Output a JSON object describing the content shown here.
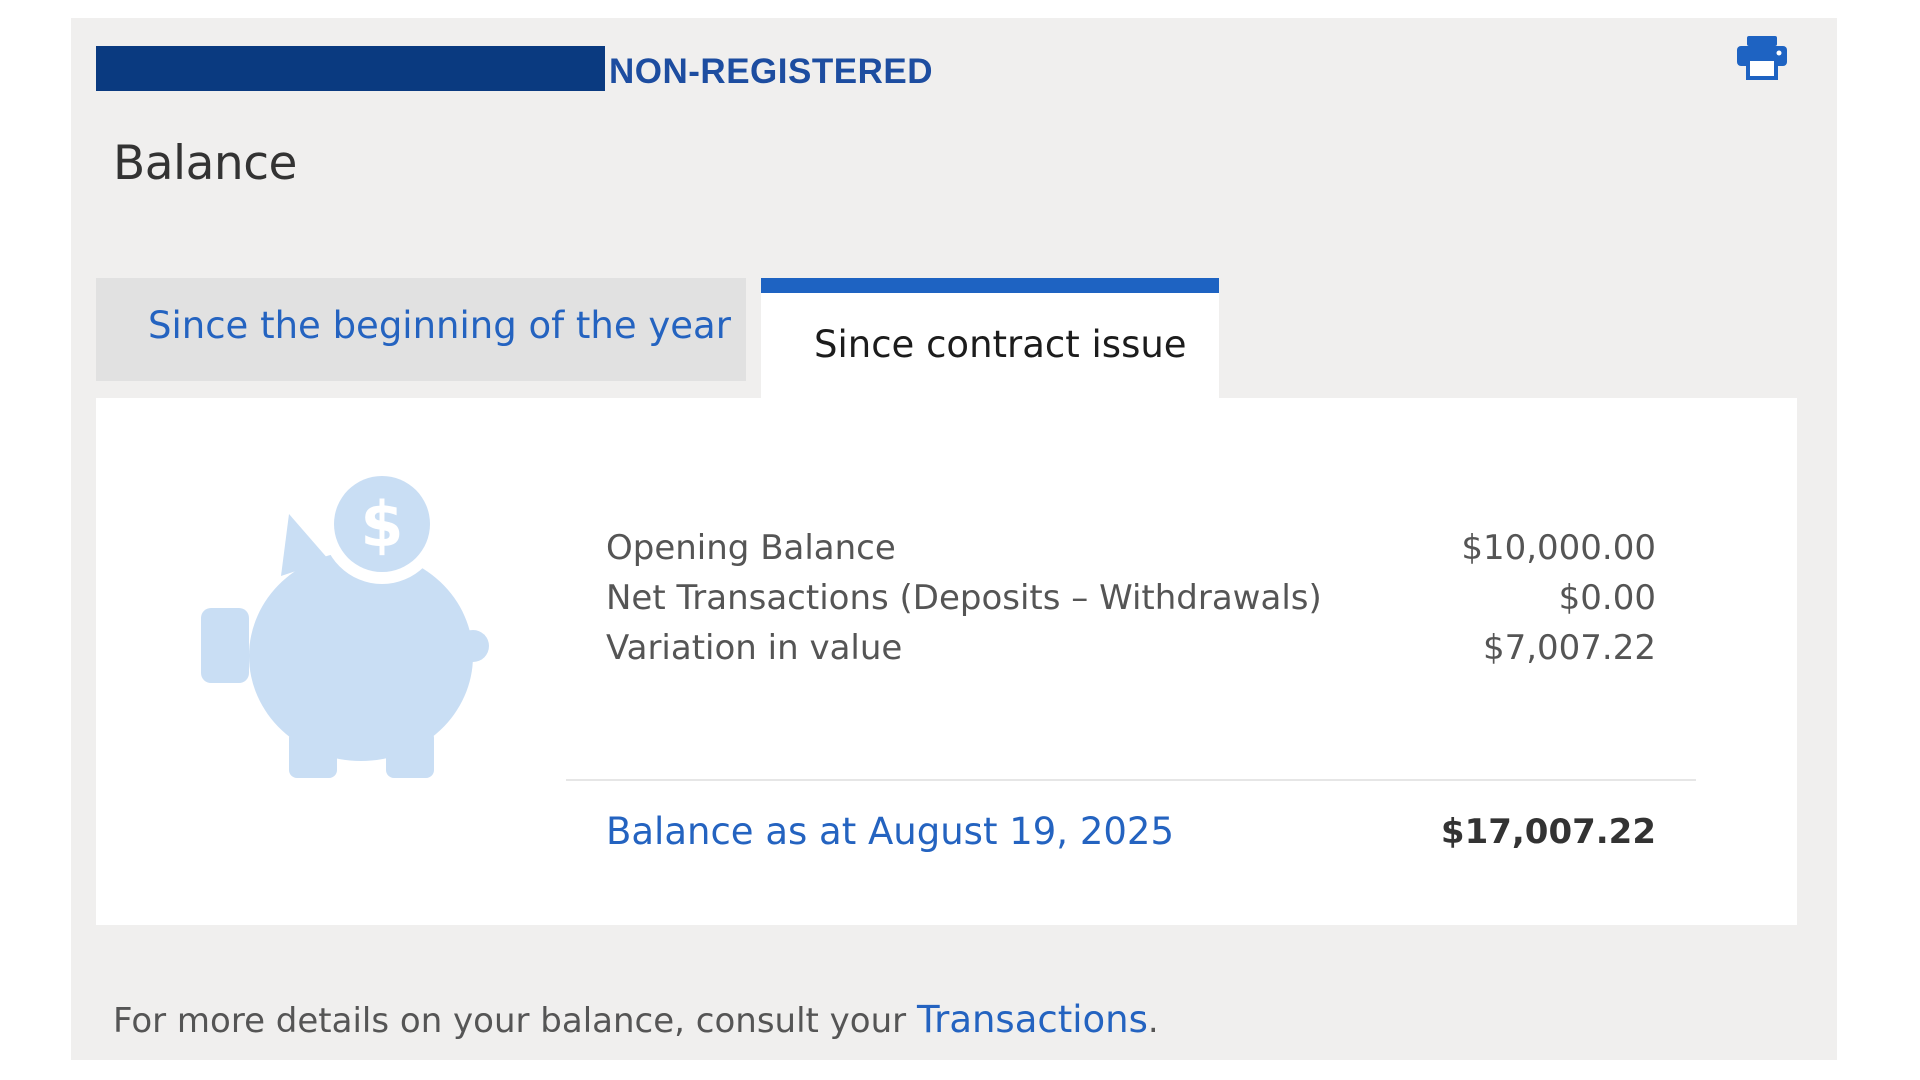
{
  "header": {
    "account_type": "NON-REGISTERED",
    "print_icon": "printer-icon"
  },
  "page_title": "Balance",
  "tabs": [
    {
      "label": "Since the beginning of the year",
      "active": false
    },
    {
      "label": "Since contract issue",
      "active": true
    }
  ],
  "illustration": "piggy-bank-dollar-icon",
  "summary": {
    "rows": [
      {
        "label": "Opening Balance",
        "amount": "$10,000.00"
      },
      {
        "label": "Net Transactions (Deposits – Withdrawals)",
        "amount": "$0.00"
      },
      {
        "label": "Variation in value",
        "amount": "$7,007.22"
      }
    ],
    "total": {
      "label": "Balance as at August 19, 2025",
      "amount": "$17,007.22"
    }
  },
  "footer": {
    "text": "For more details on your balance, consult your",
    "link": "Transactions",
    "suffix": "."
  },
  "colors": {
    "brand_blue": "#1d4da0",
    "link_blue": "#2463c0",
    "tab_accent": "#1e63c2",
    "panel_bg": "#f0efee",
    "piggy": "#c9def4"
  }
}
